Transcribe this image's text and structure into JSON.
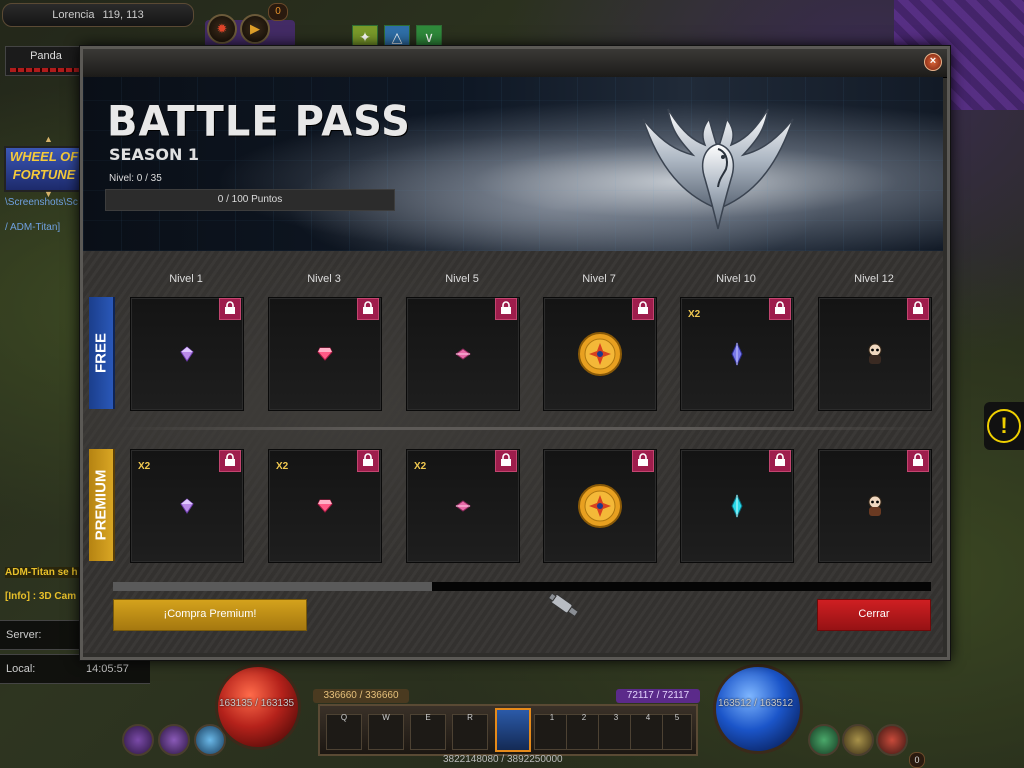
{
  "hud": {
    "location": "Lorencia",
    "coords": "119, 113",
    "notify_count": "0",
    "party_member": "Panda",
    "wheel_banner": "WHEEL OF FORTUNE",
    "chat_lines": [
      "\\Screenshots\\Sc",
      "/ ADM-Titan]"
    ],
    "notice_1": "ADM-Titan se h",
    "notice_2": "[Info] : 3D Cam",
    "server_label": "Server:",
    "local_label": "Local:",
    "local_time": "14:05:57",
    "hp_text": "163135 / 163135",
    "mp_text": "163512 / 163512",
    "ag_text": "336660 / 336660",
    "sd_text": "72117 / 72117",
    "exp_text": "3822148080  /  3892250000",
    "skill_keys": [
      "Q",
      "W",
      "E",
      "R"
    ],
    "slot_numbers": [
      "1",
      "2",
      "3",
      "4",
      "5"
    ],
    "bottom_badge": "0"
  },
  "window": {
    "title": "BATTLE PASS",
    "season": "SEASON 1",
    "level_text": "Nivel: 0 / 35",
    "points_text": "0 / 100 Puntos",
    "close_glyph": "×",
    "columns": [
      "Nivel 1",
      "Nivel 3",
      "Nivel 5",
      "Nivel 7",
      "Nivel 10",
      "Nivel 12"
    ],
    "free_label": "FREE",
    "premium_label": "PREMIUM",
    "free_rewards": [
      {
        "item": "purple-gem",
        "mult": ""
      },
      {
        "item": "pink-gem",
        "mult": ""
      },
      {
        "item": "pink-crystal",
        "mult": ""
      },
      {
        "item": "gold-coin",
        "mult": ""
      },
      {
        "item": "blue-crystal",
        "mult": "X2"
      },
      {
        "item": "doll-figure",
        "mult": ""
      }
    ],
    "premium_rewards": [
      {
        "item": "purple-gem",
        "mult": "X2"
      },
      {
        "item": "pink-gem",
        "mult": "X2"
      },
      {
        "item": "pink-crystal",
        "mult": "X2"
      },
      {
        "item": "gold-coin",
        "mult": ""
      },
      {
        "item": "cyan-crystal",
        "mult": ""
      },
      {
        "item": "doll-figure",
        "mult": ""
      }
    ],
    "buy_button": "¡Compra Premium!",
    "close_button": "Cerrar",
    "scroll_position": 0.39
  },
  "colors": {
    "free_tag": "#2a58b8",
    "premium_tag": "#d9a624",
    "lock": "#9e1d4c",
    "buy": "#d4a21c",
    "close": "#cf1f22"
  }
}
